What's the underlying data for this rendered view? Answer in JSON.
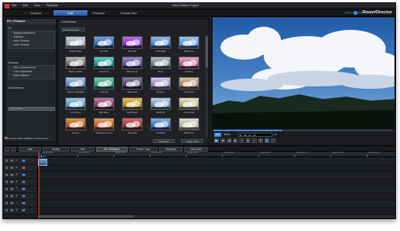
{
  "window": {
    "menu": [
      "File",
      "Edit",
      "View",
      "Playback"
    ],
    "project_title": "New Untitled Project*",
    "controls": [
      "?",
      "_",
      "□",
      "✕"
    ]
  },
  "modes": {
    "tabs": [
      {
        "label": "Capture",
        "active": false
      },
      {
        "label": "Edit",
        "active": true
      },
      {
        "label": "Produce",
        "active": false
      },
      {
        "label": "Create Disc",
        "active": false
      }
    ],
    "switch_link": "Switch to DirectorZone",
    "brand": "PowerDirector"
  },
  "fix_panel": {
    "title": "Fix / Enhance",
    "fix_header": "Fix",
    "fix_items": [
      "Lighting Adjustment",
      "Stabilizer",
      "Video Denoise",
      "Audio Denoise"
    ],
    "enhance_header": "Enhance",
    "enhance_items": [
      "Video Enhancement",
      "Color Adjustment",
      "White Balance"
    ],
    "colordirector_header": "ColorDirector",
    "color_effect_label": "Color Effect"
  },
  "presets": {
    "header_label": "ColorDirector",
    "dropdown_value": "Default Presets",
    "items": [
      {
        "label": "Bright White",
        "c1": "#c8ccd2",
        "c2": "#8a9099"
      },
      {
        "label": "Fix Cold",
        "c1": "#6ea0e8",
        "c2": "#224a8a"
      },
      {
        "label": "Fix Cold",
        "c1": "#c264f0",
        "c2": "#5b1e9a"
      },
      {
        "label": "Arctic Blue",
        "c1": "#8fb8ee",
        "c2": "#2f5fa8"
      },
      {
        "label": "Bright Life",
        "c1": "#9ac6f0",
        "c2": "#3d72b8"
      },
      {
        "label": "Black & White",
        "c1": "#b8b8b8",
        "c2": "#3a3a3a"
      },
      {
        "label": "Cold Tone",
        "c1": "#5fd0c8",
        "c2": "#1b6068"
      },
      {
        "label": "Warm Tone",
        "c1": "#9a8ad6",
        "c2": "#382e70"
      },
      {
        "label": "Retro",
        "c1": "#b8bcc4",
        "c2": "#4f5560"
      },
      {
        "label": "Fantasy",
        "c1": "#e6a6c8",
        "c2": "#8a3060"
      },
      {
        "label": "Classic Highlights",
        "c1": "#a8c6e6",
        "c2": "#355a84"
      },
      {
        "label": "Cold Pop",
        "c1": "#6ed0b0",
        "c2": "#1f6a58"
      },
      {
        "label": "Dark Dust",
        "c1": "#8a7aa8",
        "c2": "#2a2040"
      },
      {
        "label": "Dreamy",
        "c1": "#d8c8ee",
        "c2": "#6a5a96"
      },
      {
        "label": "Dusty Film",
        "c1": "#d8c0a8",
        "c2": "#7a5a3e"
      },
      {
        "label": "In a Dream",
        "c1": "#9ad0ee",
        "c2": "#2e6a94"
      },
      {
        "label": "Red Rose",
        "c1": "#c67aa6",
        "c2": "#5a1e3c"
      },
      {
        "label": "Red Desert",
        "c1": "#e8c850",
        "c2": "#8a5a10"
      },
      {
        "label": "Silent Ice",
        "c1": "#b8d2ee",
        "c2": "#4a6f98"
      },
      {
        "label": "Sunny Day",
        "c1": "#e8e4c0",
        "c2": "#8a8a5a"
      },
      {
        "label": "Sunset",
        "c1": "#e89848",
        "c2": "#7a3410"
      },
      {
        "label": "Tangerine Dream",
        "c1": "#f0a060",
        "c2": "#8a3a18"
      },
      {
        "label": "Tech Red",
        "c1": "#d86a6a",
        "c2": "#6a1a1a"
      },
      {
        "label": "True Blue",
        "c1": "#7ab0f0",
        "c2": "#1f4a9a"
      },
      {
        "label": "Wash Out",
        "c1": "#e0dccc",
        "c2": "#9a9684"
      }
    ],
    "keyframe_label": "Keyframe",
    "apply_all_label": "Apply to All",
    "compare_label": "Compare video qualities in split preview"
  },
  "preview": {
    "clip_label": "Clip",
    "movie_label": "Movie",
    "timecode": "00 ; 00 ; 02 ; 28",
    "fps": "Fit",
    "progress": 0.38
  },
  "toolbar": {
    "buttons": [
      {
        "label": "Split",
        "active": false
      },
      {
        "label": "Modify",
        "active": false
      },
      {
        "label": "Trim",
        "active": false
      },
      {
        "label": "Fix / Enhance",
        "active": true
      },
      {
        "label": "Power Tools",
        "active": false
      },
      {
        "label": "Keyframe",
        "active": false
      },
      {
        "label": "Edit Audio",
        "active": false
      }
    ]
  },
  "timeline": {
    "clip_name": "Output 1",
    "ruler_labels": [
      "00;00;00;00",
      "00;00;08;10",
      "00;00;16;20",
      "00;00;25;00",
      "00;00;33;10",
      "00;00;41;20",
      "00;00;50;00",
      "00;00;58;10",
      "00;01;06;20",
      "00;01;15;00"
    ],
    "tracks": [
      "1",
      "1",
      "2",
      "2",
      "T",
      "3",
      "♪",
      "4"
    ]
  },
  "colors": {
    "accent": "#3e8de0",
    "background": "#1c1e21",
    "playhead": "#e23b3b"
  }
}
